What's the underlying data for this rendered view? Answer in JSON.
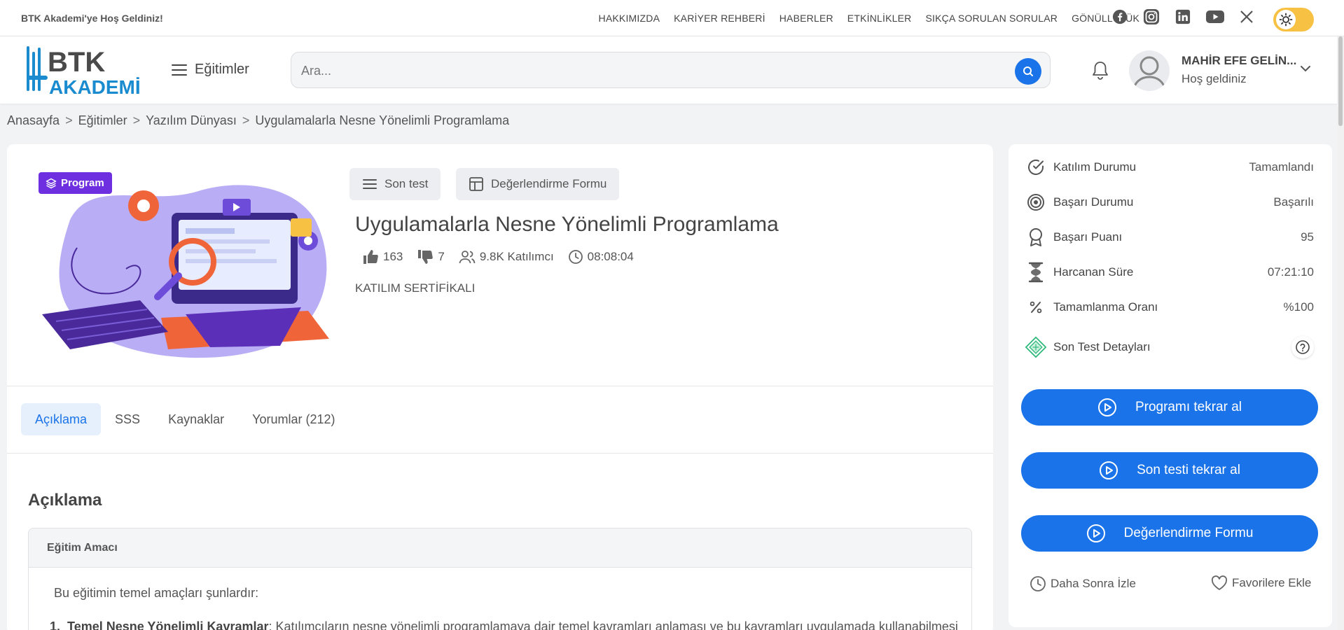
{
  "topbar": {
    "welcome": "BTK Akademi'ye Hoş Geldiniz!",
    "nav": [
      "HAKKIMIZDA",
      "KARİYER REHBERİ",
      "HABERLER",
      "ETKİNLİKLER",
      "SIKÇA SORULAN SORULAR",
      "GÖNÜLLÜLÜK"
    ],
    "socials": [
      "facebook-icon",
      "instagram-icon",
      "linkedin-icon",
      "youtube-icon",
      "x-icon"
    ]
  },
  "header": {
    "logo_text_top": "BTK",
    "logo_text_bottom": "AKADEMİ",
    "menu_label": "Eğitimler",
    "search_placeholder": "Ara...",
    "user_name": "MAHİR EFE GELİN...",
    "user_greeting": "Hoş geldiniz"
  },
  "breadcrumb": [
    "Anasayfa",
    "Eğitimler",
    "Yazılım Dünyası",
    "Uygulamalarla Nesne Yönelimli Programlama"
  ],
  "breadcrumb_sep": ">",
  "course": {
    "badge": "Program",
    "actions": [
      "Son test",
      "Değerlendirme Formu"
    ],
    "title": "Uygulamalarla Nesne Yönelimli Programlama",
    "likes": "163",
    "dislikes": "7",
    "participants": "9.8K Katılımcı",
    "duration": "08:08:04",
    "certificate": "KATILIM SERTİFİKALI"
  },
  "tabs": [
    "Açıklama",
    "SSS",
    "Kaynaklar",
    "Yorumlar (212)"
  ],
  "description": {
    "heading": "Açıklama",
    "accordion_title": "Eğitim Amacı",
    "intro": "Bu eğitimin temel amaçları şunlardır:",
    "item1_num": "1.",
    "item1_title": "Temel Nesne Yönelimli Kavramlar",
    "item1_text": ": Katılımcıların nesne yönelimli programlamaya dair temel kavramları anlaması ve bu kavramları uygulamada kullanabilmesi"
  },
  "sidebar": {
    "rows": [
      {
        "label": "Katılım Durumu",
        "value": "Tamamlandı",
        "icon": "check-circle-icon"
      },
      {
        "label": "Başarı Durumu",
        "value": "Başarılı",
        "icon": "target-icon"
      },
      {
        "label": "Başarı Puanı",
        "value": "95",
        "icon": "award-icon"
      },
      {
        "label": "Harcanan Süre",
        "value": "07:21:10",
        "icon": "hourglass-icon"
      },
      {
        "label": "Tamamlanma Oranı",
        "value": "%100",
        "icon": "percent-icon"
      },
      {
        "label": "Son Test Detayları",
        "value": "",
        "icon": "test-details-icon"
      }
    ],
    "buttons": [
      "Programı tekrar al",
      "Son testi tekrar al",
      "Değerlendirme Formu"
    ],
    "watch_later": "Daha Sonra İzle",
    "favorites": "Favorilere Ekle"
  },
  "colors": {
    "primary": "#1a73e8",
    "badge": "#6d2fdf",
    "logo": "#1b8bd0",
    "toggle": "#f7c144"
  }
}
